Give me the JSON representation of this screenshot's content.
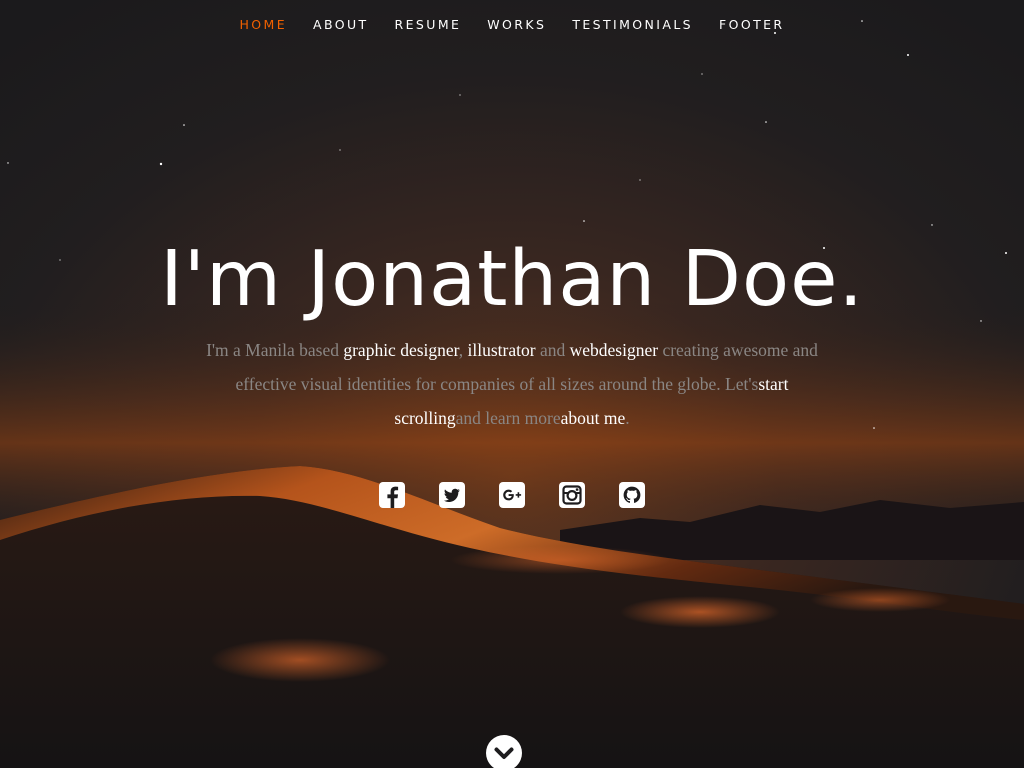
{
  "nav": {
    "items": [
      "HOME",
      "ABOUT",
      "RESUME",
      "WORKS",
      "TESTIMONIALS",
      "FOOTER"
    ],
    "active": "HOME"
  },
  "hero": {
    "headline": "I'm Jonathan Doe.",
    "intro": {
      "t1": "I'm a Manila based ",
      "h1": "graphic designer",
      "t2": ", ",
      "h2": "illustrator",
      "t3": " and ",
      "h3": "webdesigner",
      "t4": " creating awesome and effective visual identities for companies of all sizes around the globe. Let's",
      "h4": "start scrolling",
      "t5": "and learn more",
      "h5": "about me",
      "t6": "."
    }
  },
  "social": [
    "facebook-icon",
    "twitter-icon",
    "google-plus-icon",
    "instagram-icon",
    "github-icon"
  ],
  "scroll_icon": "chevron-down-circle-icon",
  "colors": {
    "accent": "#f06000",
    "background": "#1d1c1e",
    "headline": "#ffffff",
    "body_text": "#8a8684"
  }
}
